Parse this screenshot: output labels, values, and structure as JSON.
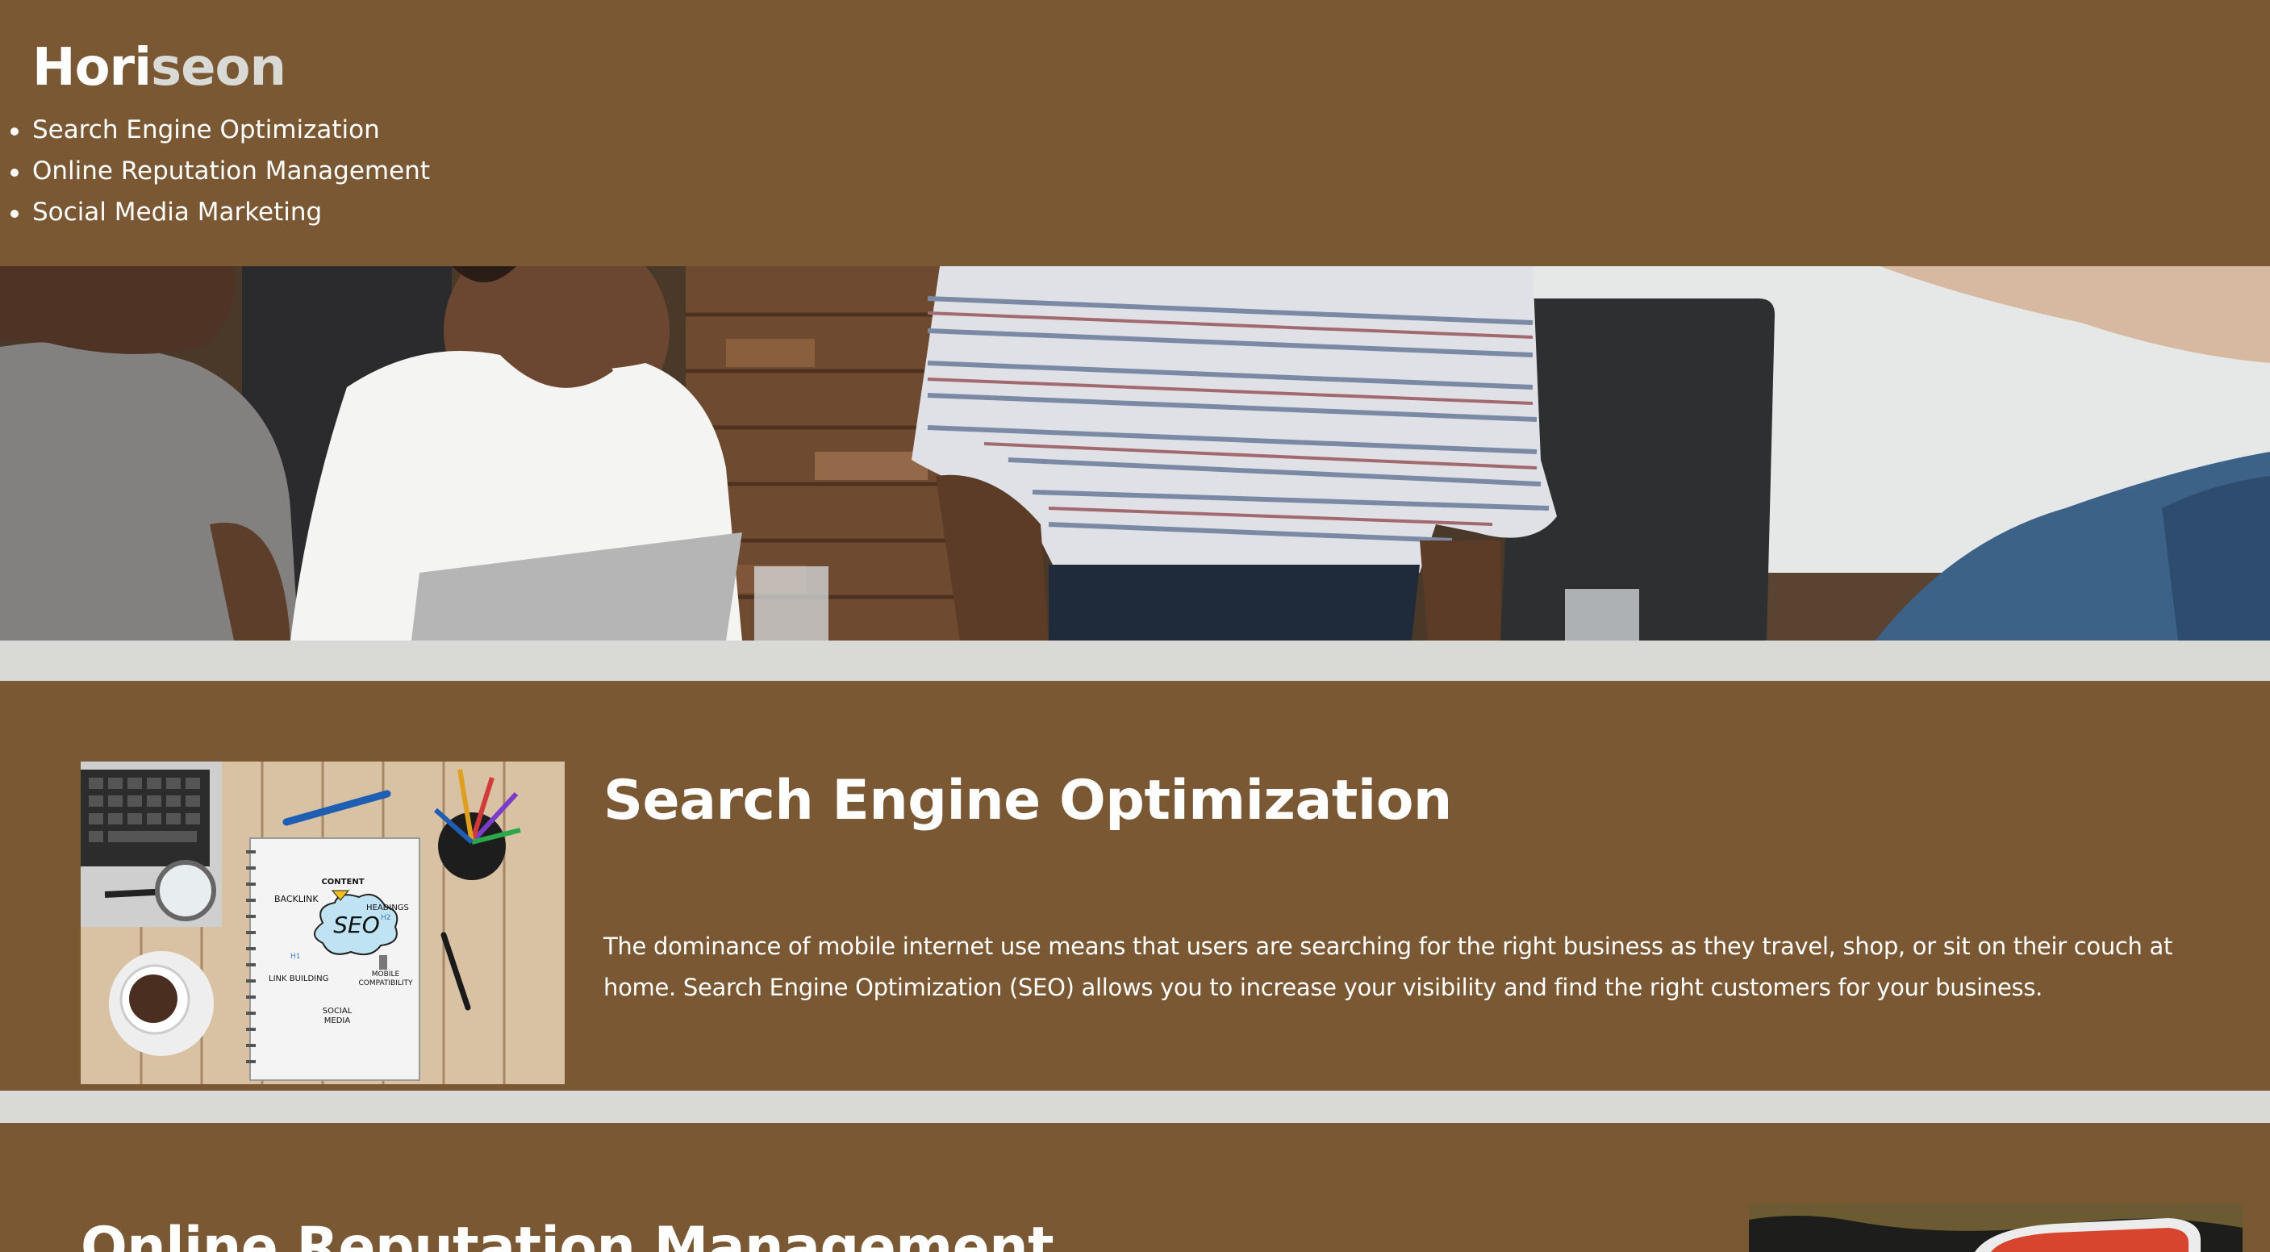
{
  "header": {
    "logo_prefix": "Hori",
    "logo_accent": "seon",
    "nav": [
      "Search Engine Optimization",
      "Online Reputation Management",
      "Social Media Marketing"
    ]
  },
  "hero": {
    "image_name": "team-meeting-photo"
  },
  "sections": [
    {
      "title": "Search Engine Optimization",
      "text": "The dominance of mobile internet use means that users are searching for the right business as they travel, shop, or sit on their couch at home. Search Engine Optimization (SEO) allows you to increase your visibility and find the right customers for your business.",
      "image": {
        "name": "seo-notebook-photo",
        "labels": [
          "CONTENT",
          "BACKLINK",
          "HEADINGS",
          "SEO",
          "LINK BUILDING",
          "MOBILE",
          "COMPATIBILITY",
          "SOCIAL",
          "MEDIA",
          "H1",
          "H2"
        ]
      }
    },
    {
      "title": "Online Reputation Management",
      "image": {
        "name": "reputation-management-photo"
      }
    }
  ],
  "colors": {
    "brown": "#7a5833",
    "separator": "#d9dad6",
    "text": "#ffffff"
  }
}
